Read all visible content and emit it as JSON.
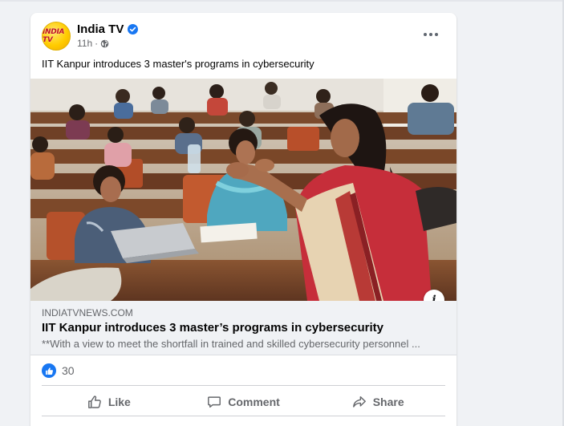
{
  "post": {
    "page_name": "India TV",
    "avatar_text": "INDIA TV",
    "verified_icon": "verified-badge-icon",
    "time": "11h",
    "separator": "·",
    "audience_icon": "globe-icon",
    "more_icon": "more-options-icon",
    "caption": "IIT Kanpur introduces 3 master's programs in cybersecurity"
  },
  "media": {
    "image_icon": "classroom-photo",
    "info_label": "i"
  },
  "link_preview": {
    "domain": "INDIATVNEWS.COM",
    "title": "IIT Kanpur introduces 3 master’s programs in cybersecurity",
    "description": "**With a view to meet the shortfall in trained and skilled cybersecurity personnel ..."
  },
  "reactions": {
    "icon": "like-reaction-icon",
    "count": "30"
  },
  "actions": {
    "like_label": "Like",
    "comment_label": "Comment",
    "share_label": "Share"
  },
  "colors": {
    "brand_blue": "#1877f2",
    "secondary_text": "#65676b",
    "background": "#f0f2f5",
    "logo_yellow": "#ffcc00",
    "logo_red": "#c1121f"
  }
}
